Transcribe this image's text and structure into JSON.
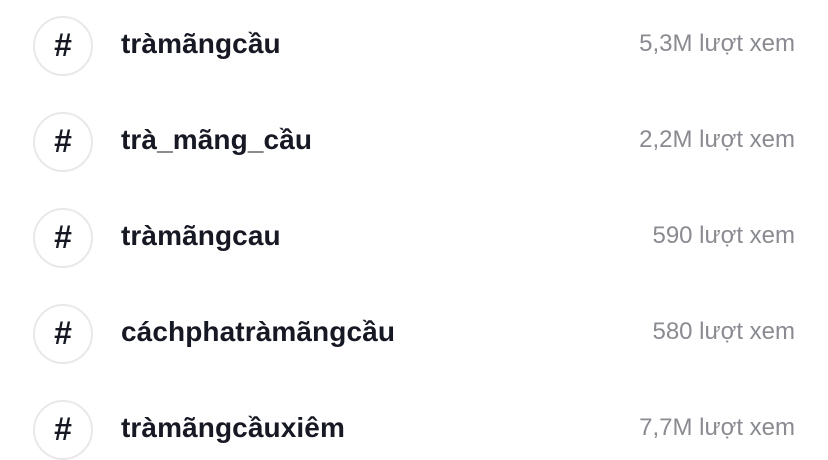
{
  "hashtags": [
    {
      "tag": "tràmãngcầu",
      "views": "5,3M lượt xem",
      "icon": "hash-icon",
      "symbol": "#"
    },
    {
      "tag": "trà_mãng_cầu",
      "views": "2,2M lượt xem",
      "icon": "hash-icon",
      "symbol": "#"
    },
    {
      "tag": "tràmãngcau",
      "views": "590 lượt xem",
      "icon": "hash-icon",
      "symbol": "#"
    },
    {
      "tag": "cáchphatràmãngcầu",
      "views": "580 lượt xem",
      "icon": "hash-icon",
      "symbol": "#"
    },
    {
      "tag": "tràmãngcầuxiêm",
      "views": "7,7M lượt xem",
      "icon": "hash-icon",
      "symbol": "#"
    }
  ],
  "colors": {
    "text_primary": "#161823",
    "text_secondary": "#8a8b91",
    "icon_border": "#e9e9ec"
  }
}
